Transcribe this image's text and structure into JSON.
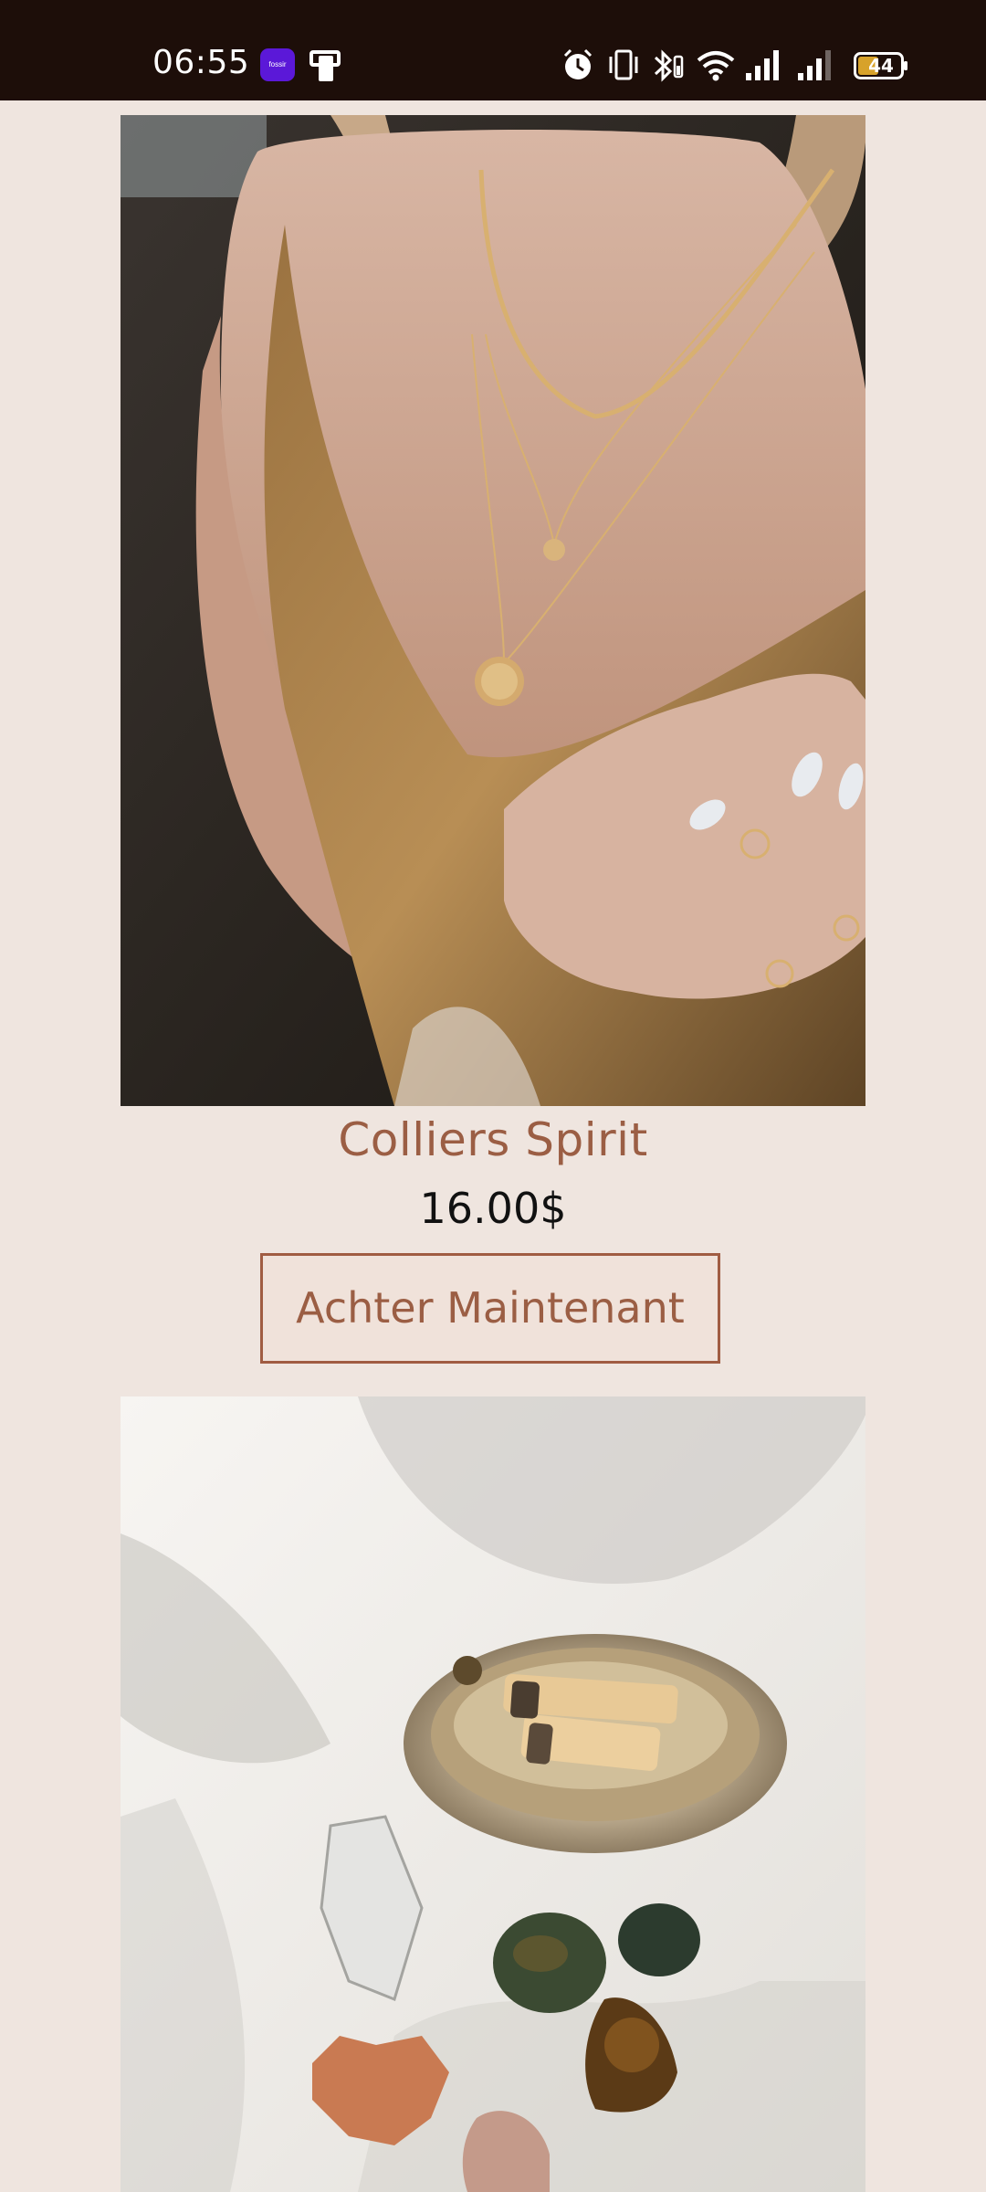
{
  "status_bar": {
    "time": "06:55",
    "app_badge_text": "fossir",
    "battery_level": "44",
    "icons": [
      "app-badge-icon",
      "phone-rotate-icon",
      "alarm-icon",
      "vibrate-icon",
      "bluetooth-icon",
      "wifi-icon",
      "signal-icon",
      "signal-icon-2",
      "battery-icon"
    ]
  },
  "products": [
    {
      "image_alt": "woman wearing gold layered necklaces",
      "name": "Colliers Spirit",
      "price": "16.00$",
      "button_label": "Achter Maintenant"
    },
    {
      "image_alt": "abalone shell with palo santo sticks and crystals"
    }
  ],
  "colors": {
    "background": "#efe5df",
    "status_bar": "#1d0e09",
    "accent": "#9b5e44",
    "button_border": "#a05c42"
  }
}
